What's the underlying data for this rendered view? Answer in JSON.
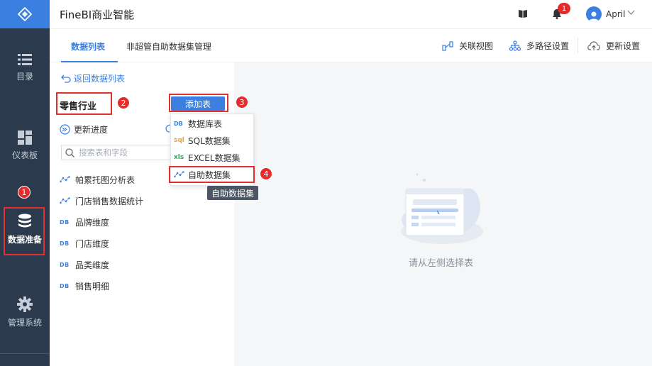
{
  "app": {
    "title": "FineBI商业智能"
  },
  "user": {
    "name": "April",
    "notification_count": "1"
  },
  "sidebar": {
    "items": [
      {
        "label": "目录",
        "icon": "list-icon"
      },
      {
        "label": "仪表板",
        "icon": "dashboard-icon"
      },
      {
        "label": "数据准备",
        "icon": "database-icon",
        "active": true
      },
      {
        "label": "管理系统",
        "icon": "gear-icon"
      }
    ]
  },
  "tabs": [
    {
      "label": "数据列表",
      "active": true
    },
    {
      "label": "非超管自助数据集管理"
    }
  ],
  "toolbar": {
    "relation_view": "关联视图",
    "multipath": "多路径设置",
    "update_settings": "更新设置"
  },
  "left": {
    "back": "返回数据列表",
    "package_title": "零售行业",
    "add_table": "添加表",
    "update_progress": "更新进度",
    "search_placeholder": "搜索表和字段",
    "tables": [
      {
        "name": "帕累托图分析表",
        "type": "self-service"
      },
      {
        "name": "门店销售数据统计",
        "type": "self-service"
      },
      {
        "name": "品牌维度",
        "type": "db"
      },
      {
        "name": "门店维度",
        "type": "db"
      },
      {
        "name": "品类维度",
        "type": "db"
      },
      {
        "name": "销售明细",
        "type": "db"
      }
    ]
  },
  "dropdown": {
    "items": [
      {
        "label": "数据库表",
        "icon_text": "DB"
      },
      {
        "label": "SQL数据集",
        "icon_text": "sql"
      },
      {
        "label": "EXCEL数据集",
        "icon_text": "xls"
      },
      {
        "label": "自助数据集",
        "icon_text": ""
      }
    ]
  },
  "tooltip": "自助数据集",
  "empty_state": "请从左侧选择表",
  "annotations": [
    "1",
    "1",
    "2",
    "3",
    "4"
  ],
  "colors": {
    "accent": "#3b7fe0",
    "sidebar": "#2b3a4d",
    "annotation": "#e0312f"
  }
}
